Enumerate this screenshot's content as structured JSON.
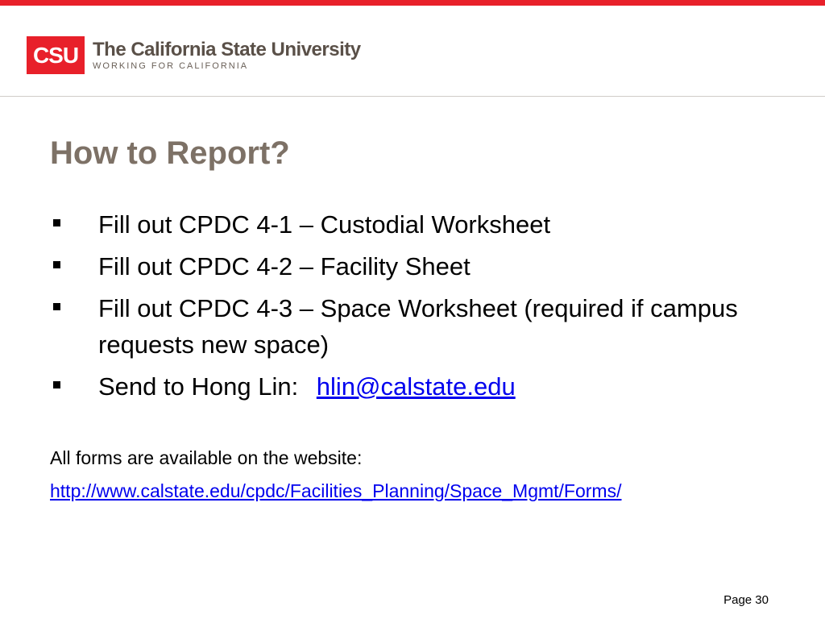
{
  "logo": {
    "mark": "CSU",
    "name": "The California State University",
    "tagline": "WORKING FOR CALIFORNIA"
  },
  "slide": {
    "title": "How to Report?",
    "bullets": [
      {
        "text": "Fill out CPDC 4-1  – Custodial Worksheet"
      },
      {
        "text": "Fill out CPDC 4-2 – Facility Sheet"
      },
      {
        "text": "Fill out CPDC 4-3 – Space Worksheet (required if campus requests new space)"
      },
      {
        "text": "Send to Hong Lin: ",
        "link": "hlin@calstate.edu"
      }
    ],
    "note": "All forms are available on the website:",
    "note_link": "http://www.calstate.edu/cpdc/Facilities_Planning/Space_Mgmt/Forms/"
  },
  "footer": {
    "page": "Page 30"
  },
  "colors": {
    "brand_red": "#e8202a",
    "title_gray": "#7d7166",
    "link_blue": "#0000ee"
  }
}
